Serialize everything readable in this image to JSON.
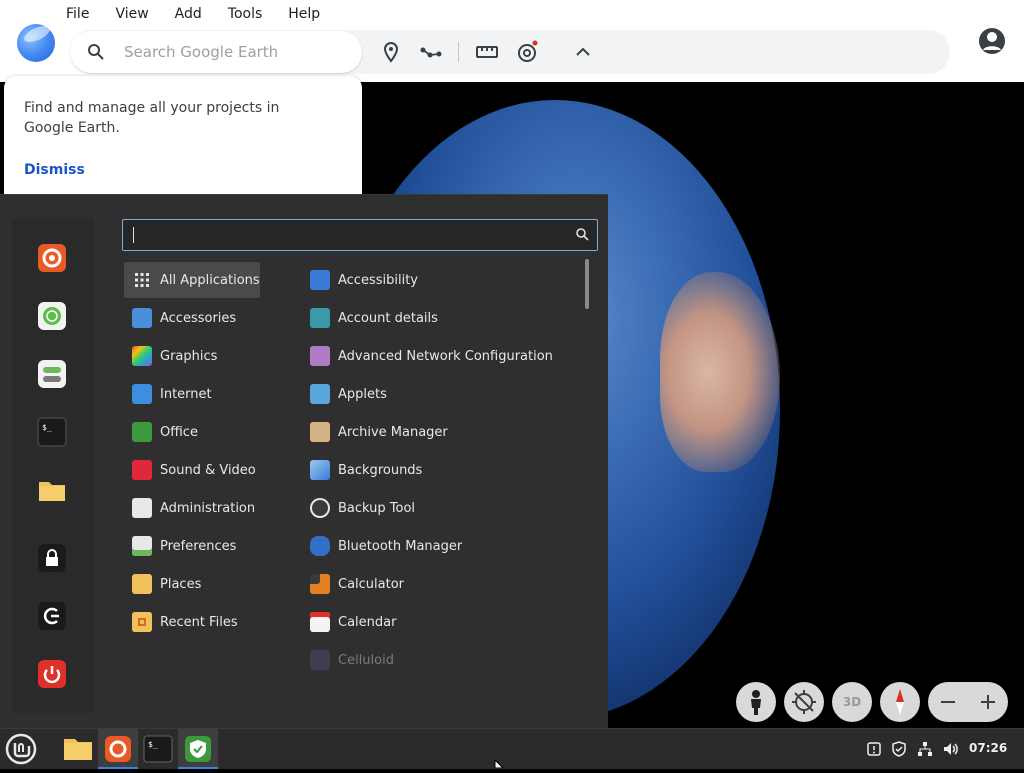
{
  "app": {
    "menu": [
      "File",
      "View",
      "Add",
      "Tools",
      "Help"
    ],
    "search_placeholder": "Search Google Earth"
  },
  "banner": {
    "text": "Find and manage all your projects in Google Earth.",
    "dismiss": "Dismiss"
  },
  "map_controls": {
    "three_d": "3D"
  },
  "start_menu": {
    "search_value": "",
    "categories": [
      "All Applications",
      "Accessories",
      "Graphics",
      "Internet",
      "Office",
      "Sound & Video",
      "Administration",
      "Preferences",
      "Places",
      "Recent Files"
    ],
    "applications": [
      "Accessibility",
      "Account details",
      "Advanced Network Configuration",
      "Applets",
      "Archive Manager",
      "Backgrounds",
      "Backup Tool",
      "Bluetooth Manager",
      "Calculator",
      "Calendar",
      "Celluloid"
    ]
  },
  "taskbar": {
    "clock": "07:26"
  },
  "colors": {
    "accent": "#1a56c9",
    "menu_bg": "#2f2f2f",
    "taskbar_bg": "#2b2b2b"
  }
}
